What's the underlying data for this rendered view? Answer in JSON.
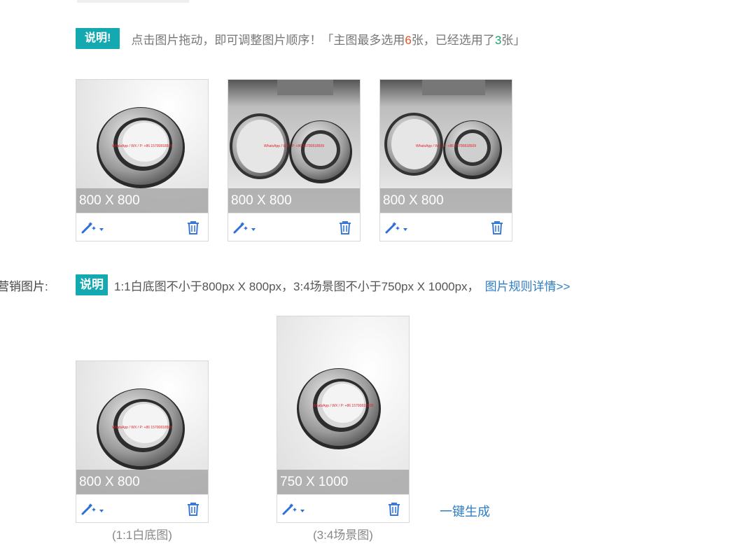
{
  "notice": {
    "badge": "说明!",
    "message_prefix": "点击图片拖动，即可调整图片顺序！「主图最多选用",
    "max_count": "6",
    "message_mid": "张，已经选用了",
    "used_count": "3",
    "message_suffix": "张」"
  },
  "main_images": [
    {
      "size": "800 X 800",
      "watermark": "WhatsApp / WX / P: +86 15700818509"
    },
    {
      "size": "800 X 800",
      "watermark": "WhatsApp / WX / P: +86 15700818509"
    },
    {
      "size": "800 X 800",
      "watermark": "WhatsApp / WX / P: +86 15700818509"
    }
  ],
  "marketing": {
    "label": "营销图片:",
    "badge": "说明",
    "rule_text": "1:1白底图不小于800px X 800px，3:4场景图不小于750px X 1000px，",
    "rule_link": "图片规则详情>>",
    "images": [
      {
        "size": "800 X 800",
        "caption": "(1:1白底图)",
        "watermark": "WhatsApp / WX / P: +86 15700818509"
      },
      {
        "size": "750 X 1000",
        "caption": "(3:4场景图)",
        "watermark": "WhatsApp / WX / P: +86 15700818509"
      }
    ],
    "generate_link": "一键生成"
  },
  "colors": {
    "accent": "#14a8b0",
    "link": "#2f7dc4",
    "highlight_red": "#e8501f",
    "highlight_green": "#1aa36a",
    "watermark_red": "#e0242b"
  },
  "icons": {
    "edit": "magic-wand-icon",
    "delete": "trash-icon"
  }
}
